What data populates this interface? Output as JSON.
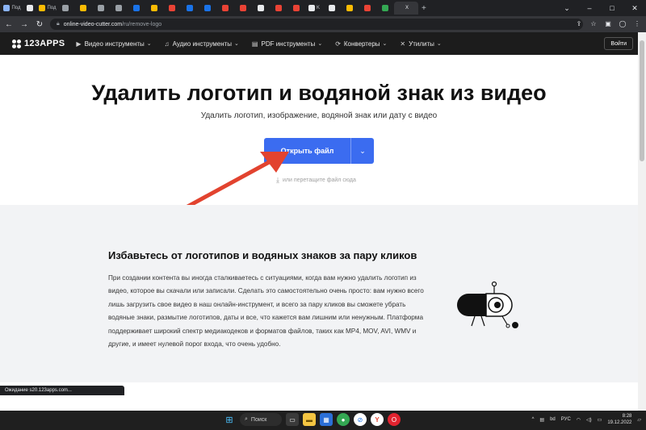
{
  "browser": {
    "tabs": [
      {
        "label": "Под",
        "color": "#8ab4f8"
      },
      {
        "label": "",
        "color": "#e8eaed"
      },
      {
        "label": "Под",
        "color": "#fbbc04"
      },
      {
        "label": "",
        "color": "#9aa0a6"
      },
      {
        "label": "",
        "color": "#fbbc04"
      },
      {
        "label": "",
        "color": "#9aa0a6"
      },
      {
        "label": "",
        "color": "#9aa0a6"
      },
      {
        "label": "",
        "color": "#1a73e8"
      },
      {
        "label": "",
        "color": "#fbbc04"
      },
      {
        "label": "",
        "color": "#ea4335"
      },
      {
        "label": "",
        "color": "#1a73e8"
      },
      {
        "label": "",
        "color": "#1a73e8"
      },
      {
        "label": "",
        "color": "#ea4335"
      },
      {
        "label": "",
        "color": "#ea4335"
      },
      {
        "label": "",
        "color": "#e8eaed"
      },
      {
        "label": "",
        "color": "#ea4335"
      },
      {
        "label": "",
        "color": "#ea4335"
      },
      {
        "label": "K",
        "color": "#e8eaed"
      },
      {
        "label": "",
        "color": "#e8eaed"
      },
      {
        "label": "",
        "color": "#fbbc04"
      },
      {
        "label": "",
        "color": "#ea4335"
      },
      {
        "label": "",
        "color": "#34a853"
      }
    ],
    "active_tab_label": "X",
    "url_host": "online-video-cutter.com",
    "url_path": "/ru/remove-logo",
    "status_text": "Ожидание s20.123apps.com..."
  },
  "site": {
    "logo": "123APPS",
    "menu": [
      {
        "icon": "video-icon",
        "label": "Видео инструменты"
      },
      {
        "icon": "audio-icon",
        "label": "Аудио инструменты"
      },
      {
        "icon": "pdf-icon",
        "label": "PDF инструменты"
      },
      {
        "icon": "converter-icon",
        "label": "Конвертеры"
      },
      {
        "icon": "utilities-icon",
        "label": "Утилиты"
      }
    ],
    "login_label": "Войти"
  },
  "hero": {
    "title": "Удалить логотип и водяной знак из видео",
    "subtitle": "Удалить логотип, изображение, водяной знак или дату с видео",
    "open_button": "Открыть файл",
    "drop_hint": "или перетащите файл сюда",
    "accent": "#3b6cf0",
    "arrow_color": "#e2432f"
  },
  "feature": {
    "title": "Избавьтесь от логотипов и водяных знаков за пару кликов",
    "body": "При создании контента вы иногда сталкиваетесь с ситуациями, когда вам нужно удалить логотип из видео, которое вы скачали или записали. Сделать это самостоятельно очень просто: вам нужно всего лишь загрузить свое видео в наш онлайн-инструмент, и всего за пару кликов вы сможете убрать водяные знаки, размытие логотипов, даты и все, что кажется вам лишним или ненужным. Платформа поддерживает широкий спектр медиакодеков и форматов файлов, таких как MP4, MOV, AVI, WMV и другие, и имеет нулевой порог входа, что очень удобно."
  },
  "taskbar": {
    "search_label": "Поиск",
    "language": "РУС",
    "time": "8:28",
    "date": "19.12.2022"
  }
}
